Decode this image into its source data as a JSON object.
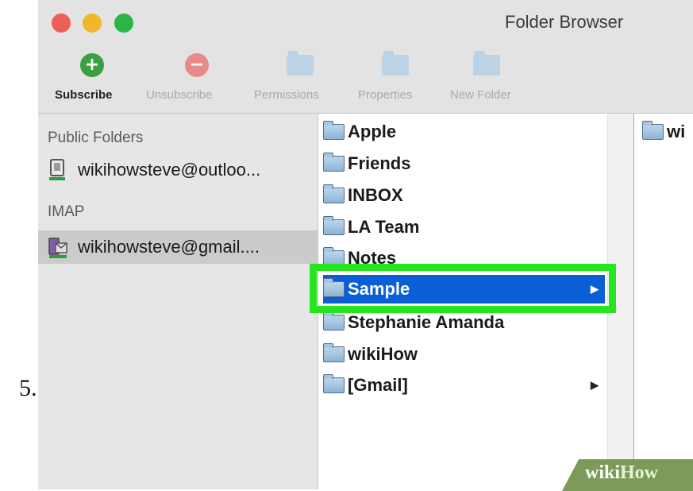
{
  "step_number": "5.",
  "window": {
    "title": "Folder Browser"
  },
  "toolbar": {
    "subscribe": "Subscribe",
    "unsubscribe": "Unsubscribe",
    "permissions": "Permissions",
    "properties": "Properties",
    "new_folder": "New Folder"
  },
  "sidebar": {
    "public_header": "Public Folders",
    "public_account": "wikihowsteve@outloo...",
    "imap_header": "IMAP",
    "imap_account": "wikihowsteve@gmail...."
  },
  "folders": [
    "Apple",
    "Friends",
    "INBOX",
    "LA Team",
    "Notes",
    "Sample",
    "Stephanie Amanda",
    "wikiHow",
    "[Gmail]"
  ],
  "selected_folder": "Sample",
  "subfolder_column": {
    "item": "wi"
  },
  "watermark": {
    "part1": "wiki",
    "part2": "How"
  },
  "colors": {
    "selection": "#0b5fd6",
    "highlight": "#26e51e"
  }
}
